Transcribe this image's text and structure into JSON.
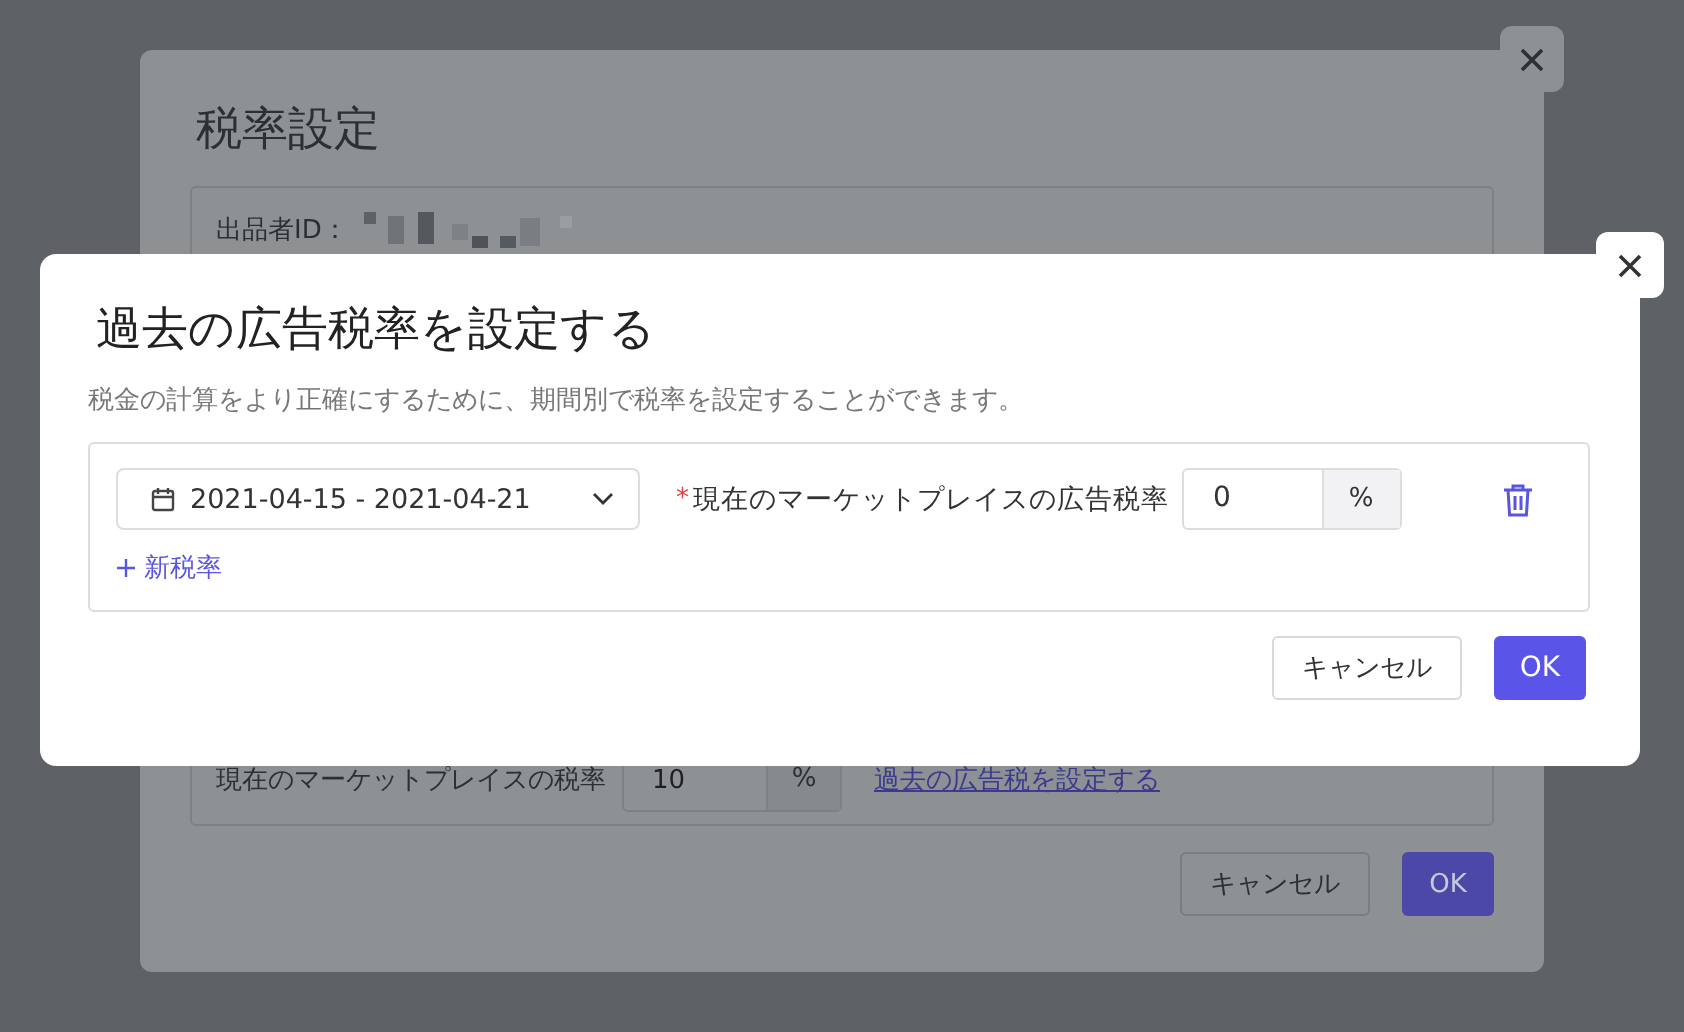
{
  "background_dialog": {
    "title": "税率設定",
    "seller_id_label": "出品者ID：",
    "rate_label": "現在のマーケットプレイスの税率",
    "rate_value": "10",
    "rate_unit": "%",
    "past_tax_link": "過去の広告税を設定する",
    "buttons": [
      {
        "label": "キャンセル",
        "kind": "default"
      },
      {
        "label": "OK",
        "kind": "primary"
      }
    ]
  },
  "dialog": {
    "title": "過去の広告税率を設定する",
    "description": "税金の計算をより正確にするために、期間別で税率を設定することができます。",
    "rates": [
      {
        "date_range": "2021-04-15 - 2021-04-21",
        "required_mark": "*",
        "label": "現在のマーケットプレイスの広告税率",
        "value": "0",
        "unit": "%"
      }
    ],
    "add_label": "新税率",
    "buttons": [
      {
        "label": "キャンセル",
        "kind": "default"
      },
      {
        "label": "OK",
        "kind": "primary"
      }
    ]
  }
}
